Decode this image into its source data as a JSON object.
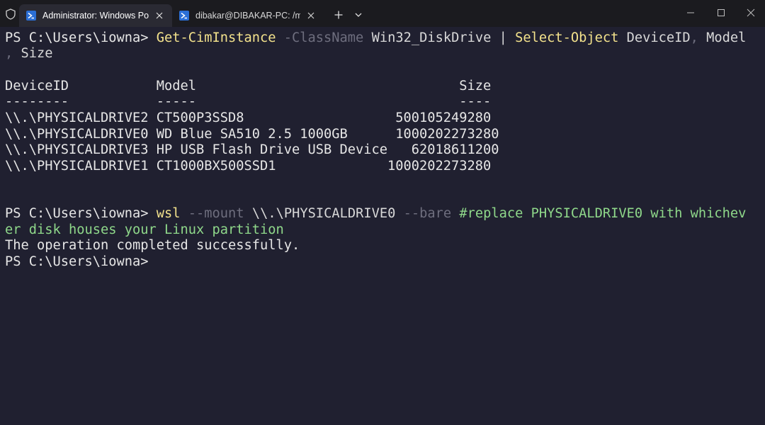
{
  "tabs": [
    {
      "title": "Administrator: Windows PowerShell",
      "active": true,
      "icon": "powershell-icon"
    },
    {
      "title": "dibakar@DIBAKAR-PC: /mnt/",
      "active": false,
      "icon": "powershell-icon"
    }
  ],
  "toolbar": {
    "new_tab_icon": "plus-icon",
    "dropdown_icon": "chevron-down-icon"
  },
  "window_controls": {
    "minimize_icon": "minimize-icon",
    "maximize_icon": "maximize-icon",
    "close_icon": "close-icon"
  },
  "colors": {
    "background": "#202030",
    "command": "#f3e28c",
    "parameter": "#6e6e7e",
    "comment": "#8fd88a",
    "text": "#e6e6e6"
  },
  "terminal": {
    "line1": {
      "prompt": "PS C:\\Users\\iowna> ",
      "cmd1": "Get-CimInstance",
      "param1": " -ClassName",
      "arg1": " Win32_DiskDrive ",
      "pipe": "|",
      "cmd2": " Select-Object",
      "arg2": " DeviceID",
      "sep1": ",",
      "arg3": " Model"
    },
    "line2": {
      "sep2": ",",
      "arg4": " Size"
    },
    "table": {
      "header": "DeviceID           Model                                 Size",
      "underline": "--------           -----                                 ----",
      "rows": [
        "\\\\.\\PHYSICALDRIVE2 CT500P3SSD8                   500105249280",
        "\\\\.\\PHYSICALDRIVE0 WD Blue SA510 2.5 1000GB      1000202273280",
        "\\\\.\\PHYSICALDRIVE3 HP USB Flash Drive USB Device   62018611200",
        "\\\\.\\PHYSICALDRIVE1 CT1000BX500SSD1              1000202273280"
      ]
    },
    "wsl_line": {
      "prompt": "PS C:\\Users\\iowna> ",
      "cmd": "wsl",
      "param1": " --mount",
      "arg": " \\\\.\\PHYSICALDRIVE0",
      "param2": " --bare",
      "comment_part1": " #replace PHYSICALDRIVE0 with whichev",
      "comment_part2": "er disk houses your Linux partition"
    },
    "result": "The operation completed successfully.",
    "final_prompt": "PS C:\\Users\\iowna>"
  }
}
